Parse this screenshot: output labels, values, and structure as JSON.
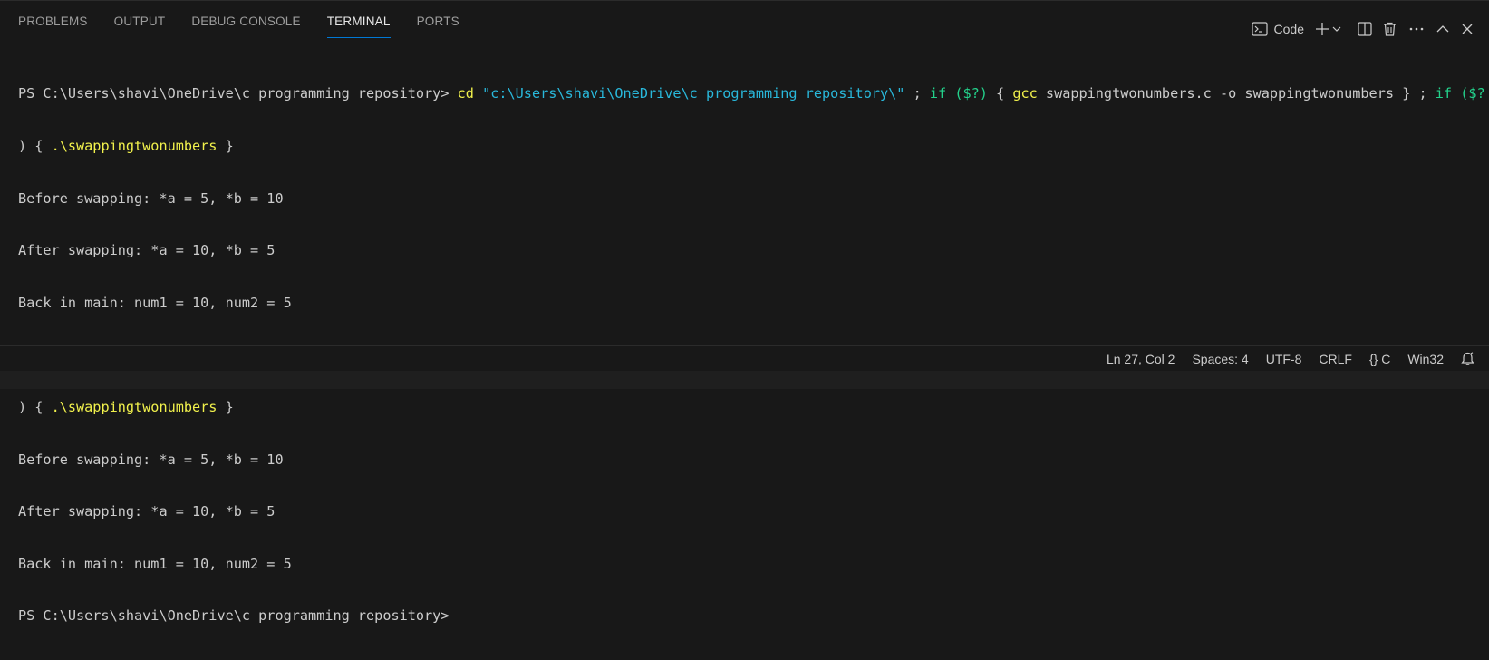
{
  "tabs": {
    "problems": "PROBLEMS",
    "output": "OUTPUT",
    "debug_console": "DEBUG CONSOLE",
    "terminal": "TERMINAL",
    "ports": "PORTS"
  },
  "actions": {
    "terminal_profile": "Code",
    "icons": [
      "terminal-icon",
      "plus-icon",
      "chevron-down-icon",
      "split-icon",
      "trash-icon",
      "more-icon",
      "chevron-up-icon",
      "close-icon"
    ]
  },
  "terminal": {
    "prompt": "PS C:\\Users\\shavi\\OneDrive\\c programming repository>",
    "cmd_cd": "cd",
    "cmd_path": "\"c:\\Users\\shavi\\OneDrive\\c programming repository\\\"",
    "sep1": " ; ",
    "kw_if": "if",
    "cond": "($?)",
    "brace_open": " { ",
    "cmd_gcc": "gcc",
    "gcc_args": "swappingtwonumbers.c",
    "flag_o": "-o",
    "out_name": "swappingtwonumbers",
    "brace_close": " }",
    "tail_cond": "($?",
    "wrap_start": ") { ",
    "exe": ".\\swappingtwonumbers",
    "wrap_end": " }",
    "out_before": "Before swapping: *a = 5, *b = 10",
    "out_after": "After swapping: *a = 10, *b = 5",
    "out_main": "Back in main: num1 = 10, num2 = 5"
  },
  "status": {
    "position": "Ln 27, Col 2",
    "spaces": "Spaces: 4",
    "encoding": "UTF-8",
    "eol": "CRLF",
    "language": "{} C",
    "platform": "Win32"
  },
  "colors": {
    "background": "#181818",
    "active_tab_underline": "#0078d4",
    "command_yellow": "#f1f14c",
    "string_cyan": "#29b8db",
    "keyword_green": "#23d18b",
    "text": "#cccccc"
  }
}
